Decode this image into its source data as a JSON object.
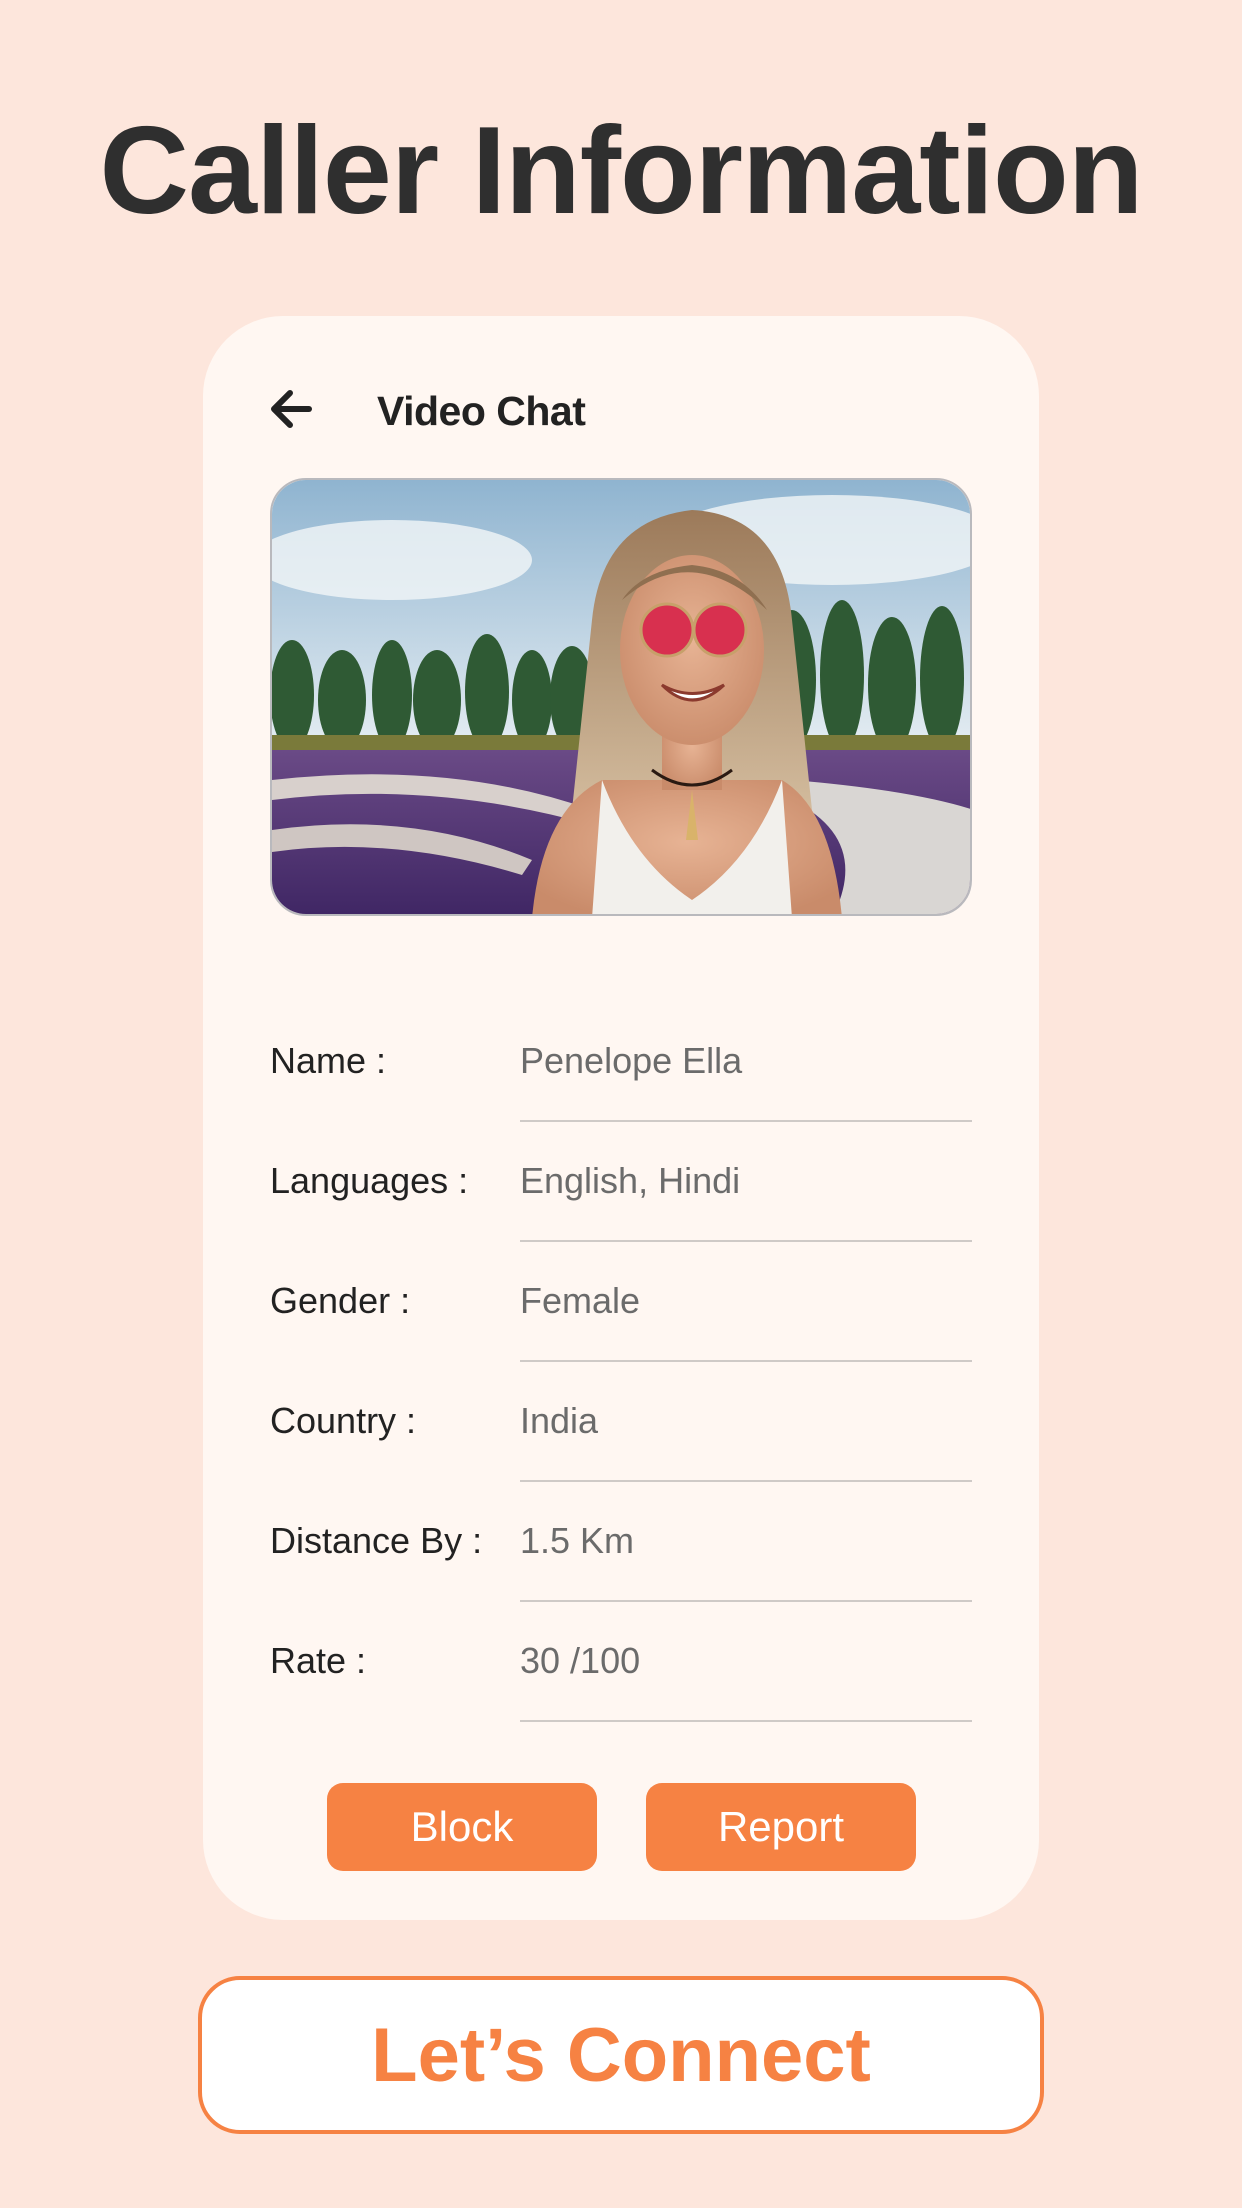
{
  "page": {
    "title": "Caller Information"
  },
  "card": {
    "header_title": "Video Chat",
    "back_icon": "arrow-left-icon",
    "photo_alt": "Smiling woman with red sunglasses in a lavender garden"
  },
  "fields": [
    {
      "label": "Name :",
      "value": "Penelope Ella"
    },
    {
      "label": "Languages :",
      "value": "English, Hindi"
    },
    {
      "label": "Gender :",
      "value": "Female"
    },
    {
      "label": "Country :",
      "value": "India"
    },
    {
      "label": "Distance By :",
      "value": "1.5 Km"
    },
    {
      "label": "Rate  :",
      "value": "30 /100"
    }
  ],
  "actions": {
    "block_label": "Block",
    "report_label": "Report"
  },
  "cta": {
    "label": "Let’s Connect"
  },
  "colors": {
    "accent": "#f68243",
    "background": "#fde6dc",
    "card": "#fff7f2"
  }
}
